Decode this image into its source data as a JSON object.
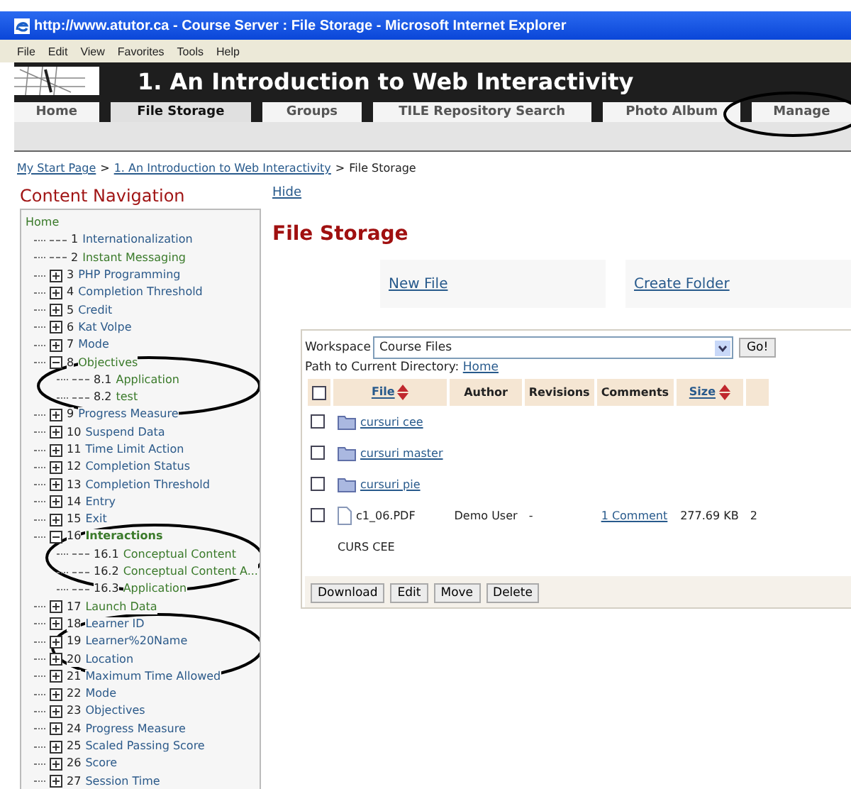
{
  "window": {
    "title": "http://www.atutor.ca - Course Server : File Storage - Microsoft Internet Explorer"
  },
  "menu_bar": [
    "File",
    "Edit",
    "View",
    "Favorites",
    "Tools",
    "Help"
  ],
  "course_title": "1. An Introduction to Web Interactivity",
  "tabs": [
    {
      "label": "Home",
      "selected": false
    },
    {
      "label": "File Storage",
      "selected": true
    },
    {
      "label": "Groups",
      "selected": false
    },
    {
      "label": "TILE Repository Search",
      "selected": false
    },
    {
      "label": "Photo Album",
      "selected": false
    },
    {
      "label": "Manage",
      "selected": false
    }
  ],
  "breadcrumb": [
    {
      "label": "My Start Page",
      "kind": "link"
    },
    {
      "label": ">",
      "kind": "separator"
    },
    {
      "label": "1. An Introduction to Web Interactivity",
      "kind": "link"
    },
    {
      "label": ">",
      "kind": "separator"
    },
    {
      "label": "File Storage",
      "kind": "current"
    }
  ],
  "content_navigation": {
    "title": "Content Navigation",
    "home": "Home",
    "items": [
      {
        "number": "1",
        "title": "Internationalization",
        "kind": "leaf",
        "visited": false,
        "current": false
      },
      {
        "number": "2",
        "title": "Instant Messaging",
        "kind": "leaf",
        "visited": true,
        "current": false
      },
      {
        "number": "3",
        "title": "PHP Programming",
        "kind": "collapsed",
        "visited": false,
        "current": false
      },
      {
        "number": "4",
        "title": "Completion Threshold",
        "kind": "collapsed",
        "visited": false,
        "current": false
      },
      {
        "number": "5",
        "title": "Credit",
        "kind": "collapsed",
        "visited": false,
        "current": false
      },
      {
        "number": "6",
        "title": "Kat Volpe",
        "kind": "collapsed",
        "visited": false,
        "current": false
      },
      {
        "number": "7",
        "title": "Mode",
        "kind": "collapsed",
        "visited": false,
        "current": false
      },
      {
        "number": "8",
        "title": "Objectives",
        "kind": "expanded",
        "visited": true,
        "current": false,
        "children": [
          {
            "number": "8.1",
            "title": "Application",
            "kind": "leaf",
            "visited": true,
            "current": false
          },
          {
            "number": "8.2",
            "title": "test",
            "kind": "leaf",
            "visited": true,
            "current": false
          }
        ]
      },
      {
        "number": "9",
        "title": "Progress Measure",
        "kind": "collapsed",
        "visited": false,
        "current": false
      },
      {
        "number": "10",
        "title": "Suspend Data",
        "kind": "collapsed",
        "visited": false,
        "current": false
      },
      {
        "number": "11",
        "title": "Time Limit Action",
        "kind": "collapsed",
        "visited": false,
        "current": false
      },
      {
        "number": "12",
        "title": "Completion Status",
        "kind": "collapsed",
        "visited": false,
        "current": false
      },
      {
        "number": "13",
        "title": "Completion Threshold",
        "kind": "collapsed",
        "visited": false,
        "current": false
      },
      {
        "number": "14",
        "title": "Entry",
        "kind": "collapsed",
        "visited": false,
        "current": false
      },
      {
        "number": "15",
        "title": "Exit",
        "kind": "collapsed",
        "visited": false,
        "current": false
      },
      {
        "number": "16",
        "title": "Interactions",
        "kind": "expanded",
        "visited": true,
        "current": true,
        "children": [
          {
            "number": "16.1",
            "title": "Conceptual Content",
            "kind": "leaf",
            "visited": true,
            "current": false
          },
          {
            "number": "16.2",
            "title": "Conceptual Content A...",
            "kind": "leaf",
            "visited": true,
            "current": false
          },
          {
            "number": "16.3",
            "title": "Application",
            "kind": "leaf",
            "visited": true,
            "current": false
          }
        ]
      },
      {
        "number": "17",
        "title": "Launch Data",
        "kind": "collapsed",
        "visited": true,
        "current": false
      },
      {
        "number": "18",
        "title": "Learner ID",
        "kind": "collapsed",
        "visited": false,
        "current": false
      },
      {
        "number": "19",
        "title": "Learner%20Name",
        "kind": "collapsed",
        "visited": false,
        "current": false
      },
      {
        "number": "20",
        "title": "Location",
        "kind": "collapsed",
        "visited": false,
        "current": false
      },
      {
        "number": "21",
        "title": "Maximum Time Allowed",
        "kind": "collapsed",
        "visited": false,
        "current": false
      },
      {
        "number": "22",
        "title": "Mode",
        "kind": "collapsed",
        "visited": false,
        "current": false
      },
      {
        "number": "23",
        "title": "Objectives",
        "kind": "collapsed",
        "visited": false,
        "current": false
      },
      {
        "number": "24",
        "title": "Progress Measure",
        "kind": "collapsed",
        "visited": false,
        "current": false
      },
      {
        "number": "25",
        "title": "Scaled Passing Score",
        "kind": "collapsed",
        "visited": false,
        "current": false
      },
      {
        "number": "26",
        "title": "Score",
        "kind": "collapsed",
        "visited": false,
        "current": false
      },
      {
        "number": "27",
        "title": "Session Time",
        "kind": "collapsed",
        "visited": false,
        "current": false
      }
    ]
  },
  "hide_link": "Hide",
  "page_title": "File Storage",
  "actions": [
    "New File",
    "Create Folder"
  ],
  "workspace": {
    "label": "Workspace",
    "value": "Course Files",
    "go": "Go!"
  },
  "path": {
    "label": "Path to Current Directory:",
    "link": "Home"
  },
  "table": {
    "select_all_checked": false,
    "columns": [
      {
        "label": "File",
        "sortable": true
      },
      {
        "label": "Author",
        "sortable": false
      },
      {
        "label": "Revisions",
        "sortable": false
      },
      {
        "label": "Comments",
        "sortable": false
      },
      {
        "label": "Size",
        "sortable": true
      }
    ],
    "rows": [
      {
        "kind": "folder",
        "name": "cursuri cee",
        "checked": false
      },
      {
        "kind": "folder",
        "name": "cursuri master",
        "checked": false
      },
      {
        "kind": "folder",
        "name": "cursuri pie",
        "checked": false
      },
      {
        "kind": "file",
        "name": "c1_06.PDF",
        "checked": false,
        "author": "Demo User",
        "revisions": "-",
        "comments": "1 Comment",
        "size": "277.69 KB",
        "column_7": "2",
        "description": "CURS CEE"
      }
    ]
  },
  "buttons": [
    "Download",
    "Edit",
    "Move",
    "Delete"
  ]
}
